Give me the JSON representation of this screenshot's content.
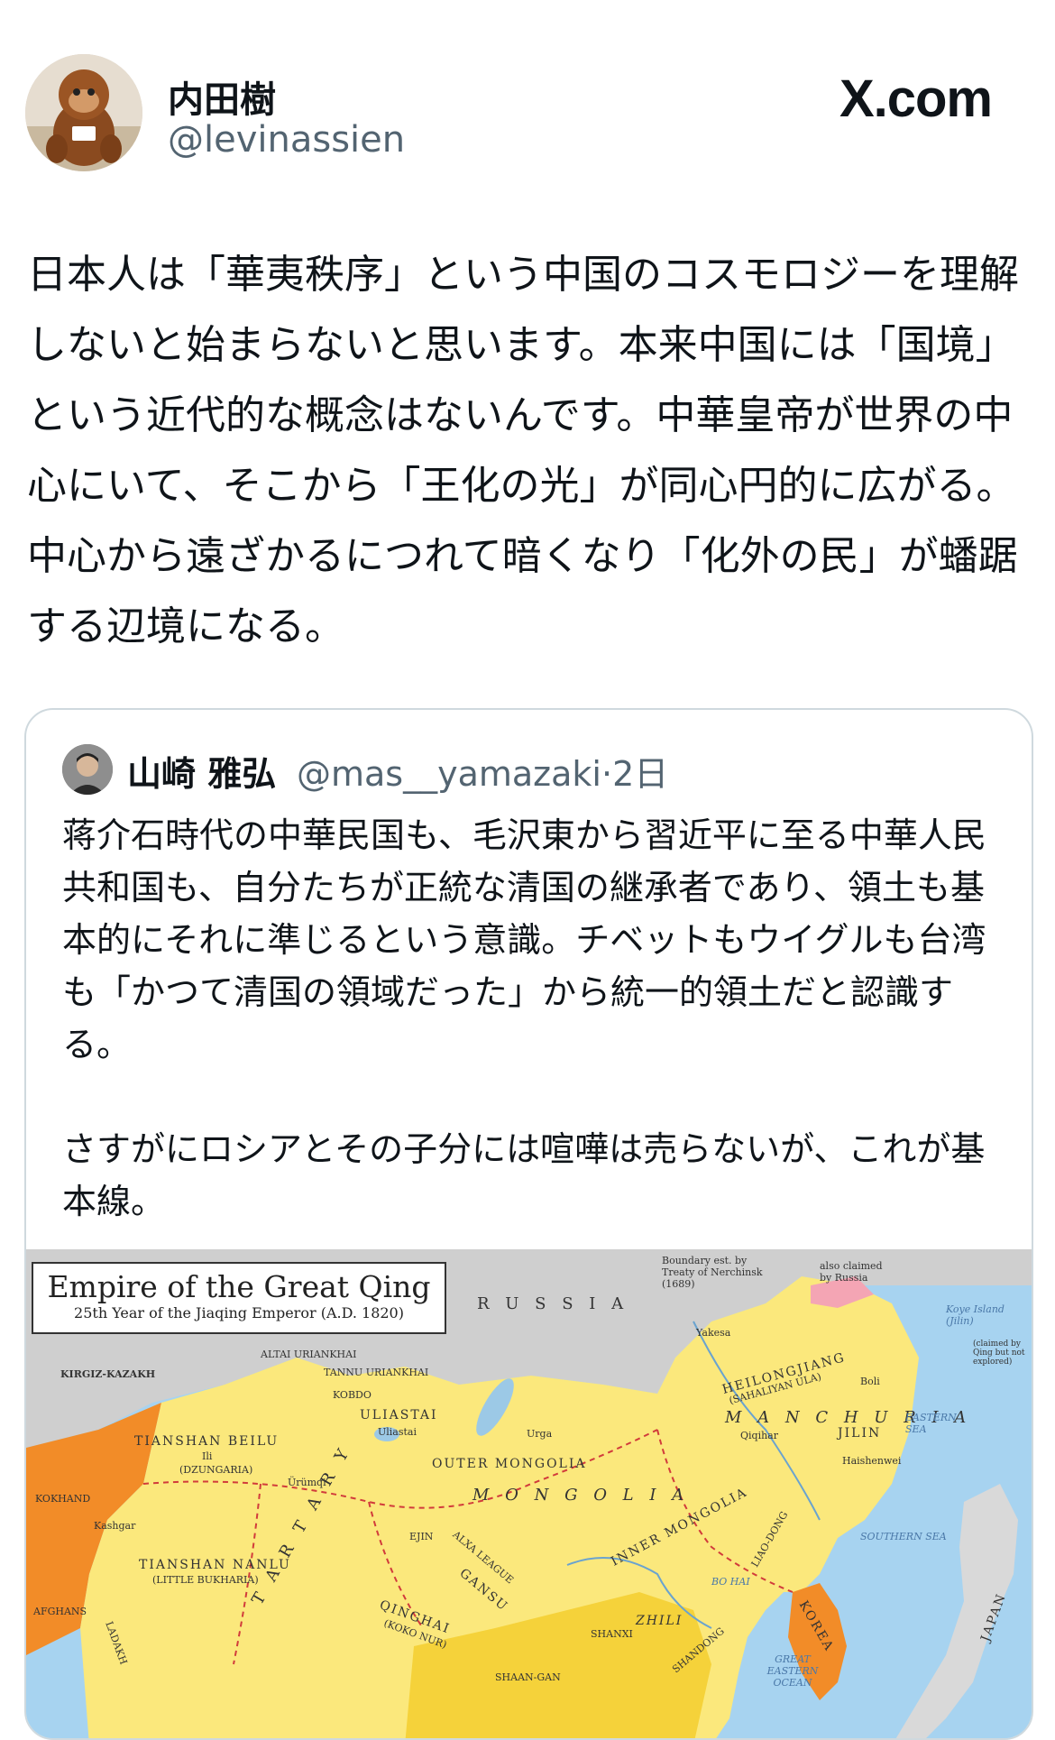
{
  "header": {
    "display_name": "内田樹",
    "handle": "@levinassien",
    "brand": "X.com"
  },
  "tweet": {
    "text": "日本人は「華夷秩序」という中国のコスモロジーを理解しないと始まらないと思います。本来中国には「国境」という近代的な概念はないんです。中華皇帝が世界の中心にいて、そこから「王化の光」が同心円的に広がる。中心から遠ざかるにつれて暗くなり「化外の民」が蟠踞する辺境になる。"
  },
  "quote": {
    "display_name": "山崎 雅弘",
    "handle": "@mas__yamazaki",
    "separator": "·",
    "time": "2日",
    "text": "蒋介石時代の中華民国も、毛沢東から習近平に至る中華人民共和国も、自分たちが正統な清国の継承者であり、領土も基本的にそれに準じるという意識。チベットもウイグルも台湾も「かつて清国の領域だった」から統一的領土だと認識する。\n\nさすがにロシアとその子分には喧嘩は売らないが、これが基本線。"
  },
  "map": {
    "title": "Empire of the Great Qing",
    "subtitle": "25th Year of the Jiaqing Emperor (A.D. 1820)",
    "labels": {
      "russia": "R U S S I A",
      "boundary": "Boundary est. by Treaty of Nerchinsk (1689)",
      "claimed": "also claimed by Russia",
      "kirgiz": "KIRGIZ-KAZAKH",
      "kokhand": "KOKHAND",
      "altai": "ALTAI URIANKHAI",
      "tannu": "TANNU URIANKHAI",
      "kobdo": "KOBDO",
      "uliastai": "ULIASTAI",
      "uliastai_city": "Uliastai",
      "urga": "Urga",
      "tianshan_beilu": "TIANSHAN BEILU",
      "ili": "Ili",
      "dzungaria": "(DZUNGARIA)",
      "urumqi": "Ürümqi",
      "tartary": "T A R T A R Y",
      "outer_mongolia": "OUTER MONGOLIA",
      "mongolia": "M O N G O L I A",
      "inner_mongolia": "INNER MONGOLIA",
      "heilongjiang": "HEILONGJIANG",
      "sahaliyan": "(SAHALIYAN ULA)",
      "manchuria": "M A N C H U R I A",
      "jilin": "JILIN",
      "qiqihar": "Qiqihar",
      "yakesa": "Yakesa",
      "boli": "Boli",
      "haishenwei": "Haishenwei",
      "eastern_sea": "EASTERN SEA",
      "koye": "Koye Island (Jilin)",
      "claimed_qing": "(claimed by Qing but not explored)",
      "kashgar": "Kashgar",
      "tianshan_nanlu": "TIANSHAN NANLU",
      "little_bukharia": "(LITTLE BUKHARIA)",
      "ejin": "EJIN",
      "alxa": "ALXA LEAGUE",
      "gansu": "GANSU",
      "qinghai": "QINGHAI",
      "koko_nur": "(KOKO NUR)",
      "shaan_gan": "SHAAN-GAN",
      "shanxi": "SHANXI",
      "zhili": "ZHILI",
      "shandong": "SHANDONG",
      "liaodong": "LIAO-DONG",
      "korea": "KOREA",
      "japan": "JAPAN",
      "southern_sea": "SOUTHERN SEA",
      "great_eastern": "GREAT EASTERN OCEAN",
      "bo_hai": "BO HAI",
      "afghans": "AFGHANS",
      "ladakh": "LADAKH"
    }
  }
}
